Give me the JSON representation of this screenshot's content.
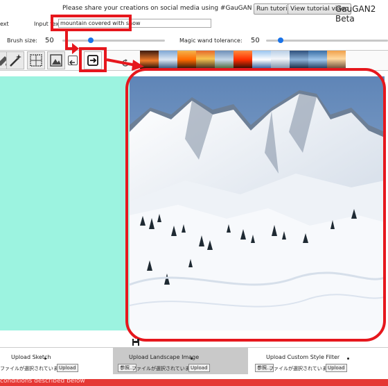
{
  "header": {
    "share_text": "Please share your creations on social media using #GauGAN",
    "run_tutorial": "Run tutorial",
    "view_tutorial_video": "View tutorial video",
    "app_title": "GauGAN2 Beta",
    "left_fragment": "ext"
  },
  "input_text": {
    "label": "Input text:",
    "value": "mountain covered with snow"
  },
  "controls": {
    "brush_size_label": "Brush size:",
    "brush_size_value": "50",
    "brush_size_level": 0.28,
    "magic_wand_label": "Magic wand tolerance:",
    "magic_wand_value": "50",
    "magic_wand_level": 0.12
  },
  "toolbar": {
    "tools": [
      "paint-bucket-icon",
      "magic-wand-icon",
      "grid-select-icon",
      "image-grid-icon",
      "undo-icon",
      "render-arrow-icon"
    ],
    "refresh_icon": "refresh-icon",
    "style_thumbnails": 11
  },
  "canvas": {
    "segmentation_color": "#9cf3e0"
  },
  "save": {
    "icon": "floppy-disk-icon"
  },
  "uploads": [
    {
      "label": "Upload Sketch",
      "file_status": "ファイルが選択されていません。",
      "button": "Upload"
    },
    {
      "label": "Upload Landscape Image",
      "browse": "参照...",
      "file_status": "ファイルが選択されていません。",
      "button": "Upload"
    },
    {
      "label": "Upload Custom Style Filter",
      "browse": "参照...",
      "file_status": "ファイルが選択されていません。",
      "button": "Upload"
    }
  ],
  "footer": {
    "text": "conditions described below"
  },
  "colors": {
    "highlight": "#e6171d",
    "slider": "#1a73e8",
    "segmentation": "#9cf3e0",
    "footer": "#e53935"
  }
}
